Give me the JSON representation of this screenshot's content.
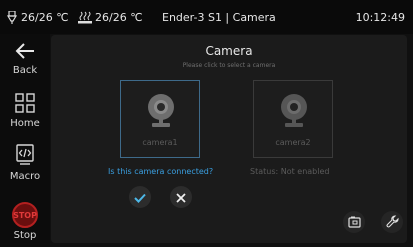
{
  "status_bar": {
    "nozzle_temp": "26/26 ℃",
    "bed_temp": "26/26 ℃",
    "title": "Ender-3 S1 | Camera",
    "clock": "10:12:49"
  },
  "sidebar": {
    "back_label": "Back",
    "home_label": "Home",
    "macro_label": "Macro",
    "stop_label": "Stop",
    "stop_badge": "STOP"
  },
  "panel": {
    "title": "Camera",
    "subtitle": "Please click to select a camera",
    "cameras": [
      {
        "label": "camera1",
        "selected": true
      },
      {
        "label": "camera2",
        "selected": false
      }
    ],
    "question": "Is this camera connected?",
    "status_text": "Status: Not enabled"
  },
  "icons": {
    "nozzle": "nozzle-icon",
    "bed": "heated-bed-icon",
    "back": "arrow-left-icon",
    "home": "grid-home-icon",
    "macro": "code-file-icon",
    "camera": "webcam-icon",
    "confirm": "check-icon",
    "cancel": "x-icon",
    "snapshot": "snapshot-icon",
    "settings": "wrench-icon"
  },
  "colors": {
    "accent": "#3a9fe0",
    "check": "#4db8e8",
    "stop": "#b32020"
  }
}
